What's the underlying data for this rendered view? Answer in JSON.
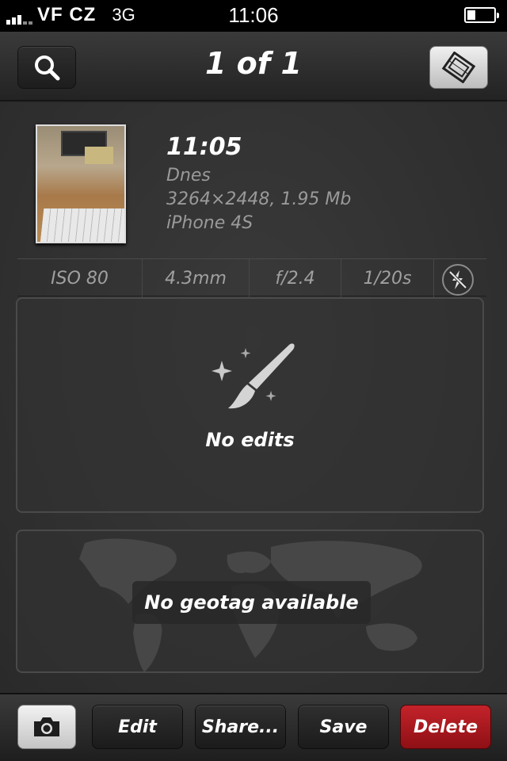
{
  "status_bar": {
    "carrier": "VF CZ",
    "network": "3G",
    "time": "11:06"
  },
  "nav": {
    "title": "1 of 1",
    "search_icon": "search-icon",
    "film_icon": "film-strip-icon"
  },
  "photo": {
    "time": "11:05",
    "date": "Dnes",
    "details": "3264×2448, 1.95 Mb",
    "camera": "iPhone 4S"
  },
  "exif": {
    "iso": "ISO 80",
    "focal": "4.3mm",
    "aperture": "f/2.4",
    "shutter": "1/20s",
    "flash_icon": "flash-off-icon"
  },
  "edits": {
    "label": "No edits",
    "icon": "paintbrush-sparkle-icon"
  },
  "geotag": {
    "label": "No geotag available"
  },
  "toolbar": {
    "camera_icon": "camera-icon",
    "edit": "Edit",
    "share": "Share...",
    "save": "Save",
    "delete": "Delete"
  },
  "colors": {
    "background": "#2b2b2b",
    "delete_button": "#b01c22",
    "text_muted": "#9a9a9a"
  }
}
